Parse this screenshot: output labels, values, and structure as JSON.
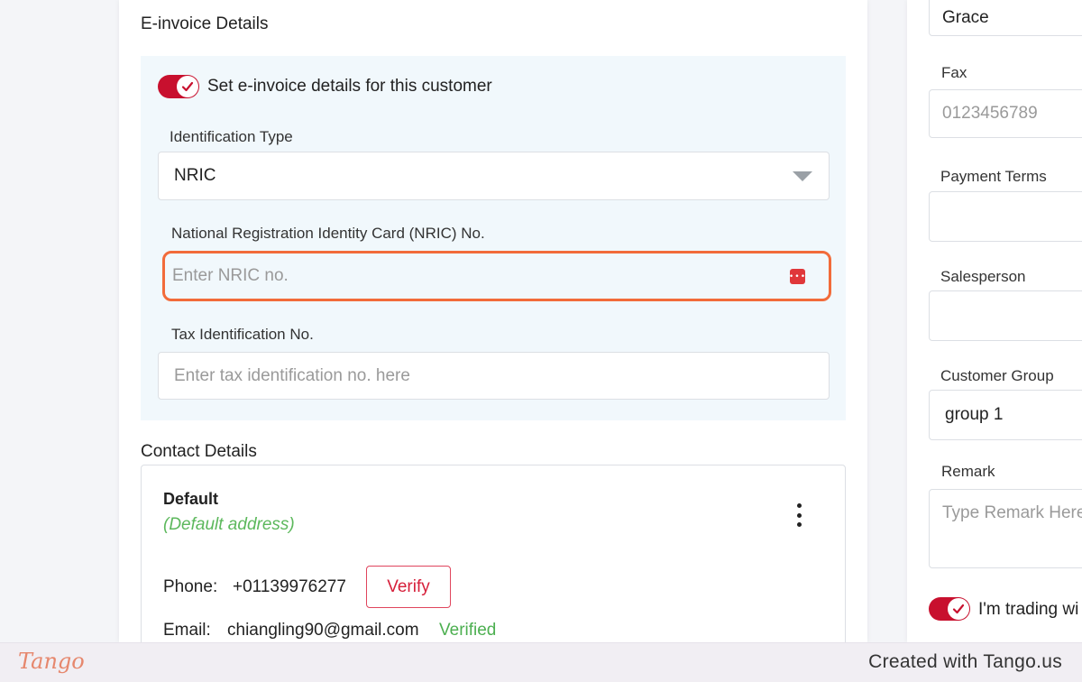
{
  "einvoice": {
    "section_title": "E-invoice Details",
    "toggle_label": "Set e-invoice details for this customer",
    "id_type_label": "Identification Type",
    "id_type_value": "NRIC",
    "nric_label": "National Registration Identity Card (NRIC) No.",
    "nric_placeholder": "Enter NRIC no.",
    "tin_label": "Tax Identification No.",
    "tin_placeholder": "Enter tax identification no. here"
  },
  "contact": {
    "section_title": "Contact Details",
    "name": "Default",
    "subtitle": "(Default address)",
    "phone_label": "Phone:",
    "phone_value": "+01139976277",
    "verify_label": "Verify",
    "email_label": "Email:",
    "email_value": "chiangling90@gmail.com",
    "email_status": "Verified"
  },
  "right_panel": {
    "top_value": "Grace",
    "fax_label": "Fax",
    "fax_placeholder": "0123456789",
    "payment_terms_label": "Payment Terms",
    "payment_terms_value": "",
    "salesperson_label": "Salesperson",
    "salesperson_value": "",
    "customer_group_label": "Customer Group",
    "customer_group_value": "group 1",
    "remark_label": "Remark",
    "remark_placeholder": "Type Remark Here",
    "trading_toggle_label": "I'm trading wi"
  },
  "footer": {
    "logo": "Tango",
    "credit": "Created with Tango.us"
  },
  "colors": {
    "accent_red": "#c8102e",
    "highlight_orange": "#f26b3a",
    "verified_green": "#4caf50",
    "panel_bg": "#f1f8fc"
  },
  "icons": [
    "check-icon",
    "chevron-down-icon",
    "password-manager-icon",
    "kebab-menu-icon"
  ]
}
